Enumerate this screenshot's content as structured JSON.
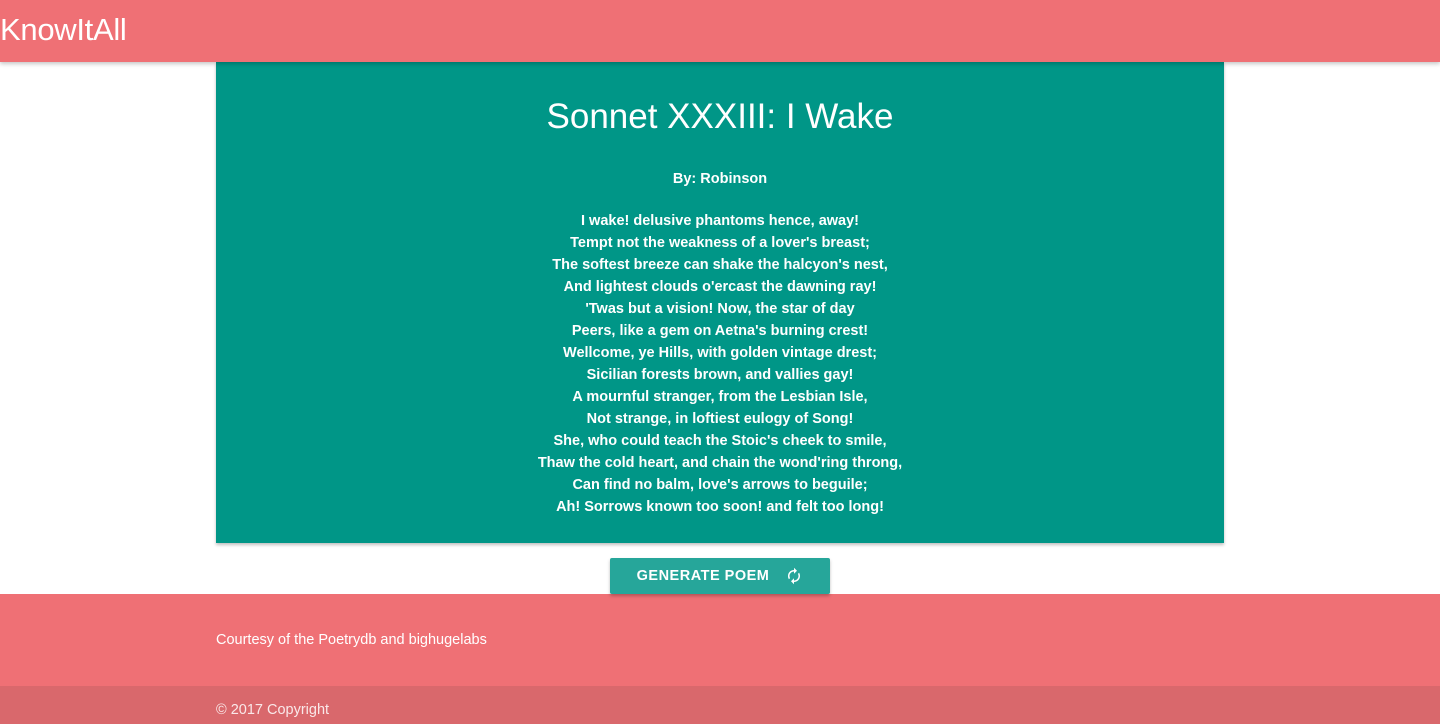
{
  "navbar": {
    "brand": "KnowItAll",
    "background": "#ef7075"
  },
  "poem": {
    "title": "Sonnet XXXIII: I Wake",
    "author": "By: Robinson",
    "background": "#009687",
    "lines": [
      "I wake! delusive phantoms hence, away!",
      "Tempt not the weakness of a lover's breast;",
      "The softest breeze can shake the halcyon's nest,",
      "And lightest clouds o'ercast the dawning ray!",
      "'Twas but a vision! Now, the star of day",
      "Peers, like a gem on Aetna's burning crest!",
      "Wellcome, ye Hills, with golden vintage drest;",
      "Sicilian forests brown, and vallies gay!",
      "A mournful stranger, from the Lesbian Isle,",
      "Not strange, in loftiest eulogy of Song!",
      "She, who could teach the Stoic's cheek to smile,",
      "Thaw the cold heart, and chain the wond'ring throng,",
      "Can find no balm, love's arrows to beguile;",
      "Ah! Sorrows known too soon! and felt too long!"
    ]
  },
  "generate_button": {
    "label": "GENERATE POEM",
    "icon": "refresh-icon",
    "background": "#26a69a"
  },
  "footer": {
    "text": "Courtesy of the Poetrydb and bighugelabs",
    "copyright": "© 2017 Copyright",
    "background": "#ef7075"
  }
}
